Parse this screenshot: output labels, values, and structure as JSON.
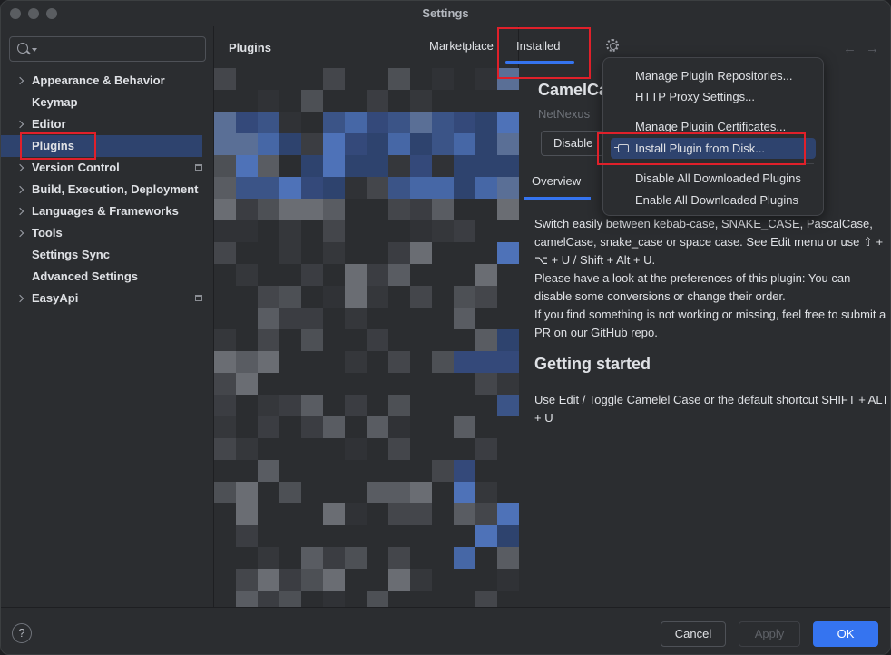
{
  "window": {
    "title": "Settings"
  },
  "sidebar": {
    "search_placeholder": "",
    "items": [
      {
        "label": "Appearance & Behavior",
        "expandable": true
      },
      {
        "label": "Keymap",
        "expandable": false
      },
      {
        "label": "Editor",
        "expandable": true
      },
      {
        "label": "Plugins",
        "expandable": false,
        "selected": true
      },
      {
        "label": "Version Control",
        "expandable": true,
        "has_icon": true
      },
      {
        "label": "Build, Execution, Deployment",
        "expandable": true
      },
      {
        "label": "Languages & Frameworks",
        "expandable": true
      },
      {
        "label": "Tools",
        "expandable": true
      },
      {
        "label": "Settings Sync",
        "expandable": false
      },
      {
        "label": "Advanced Settings",
        "expandable": false
      },
      {
        "label": "EasyApi",
        "expandable": true,
        "has_icon": true
      }
    ]
  },
  "plugins_panel": {
    "title": "Plugins",
    "tabs": {
      "marketplace": "Marketplace",
      "installed": "Installed"
    }
  },
  "detail": {
    "plugin_name": "CamelCase",
    "vendor": "NetNexus",
    "disable_label": "Disable",
    "overview_tab": "Overview",
    "description": [
      "Switch easily between kebab-case, SNAKE_CASE, PascalCase, camelCase, snake_case or space case. See Edit menu or use ⇧ + ⌥ + U / Shift + Alt + U.",
      "Please have a look at the preferences of this plugin: You can disable some conversions or change their order.",
      "If you find something is not working or missing, feel free to submit a PR on our GitHub repo."
    ],
    "getting_started_heading": "Getting started",
    "getting_started_text": "Use Edit / Toggle Camelel Case or the default shortcut SHIFT + ALT + U"
  },
  "gear_menu": {
    "items": [
      {
        "label": "Manage Plugin Repositories..."
      },
      {
        "label": "HTTP Proxy Settings..."
      },
      {
        "label": "Manage Plugin Certificates..."
      },
      {
        "label": "Install Plugin from Disk...",
        "highlighted": true
      },
      {
        "label": "Disable All Downloaded Plugins"
      },
      {
        "label": "Enable All Downloaded Plugins"
      }
    ]
  },
  "footer": {
    "help": "?",
    "cancel": "Cancel",
    "apply": "Apply",
    "ok": "OK"
  },
  "colors": {
    "accent": "#3574f0",
    "selection": "#2e436e",
    "highlight_box": "#e0202a",
    "background": "#2b2d30"
  }
}
